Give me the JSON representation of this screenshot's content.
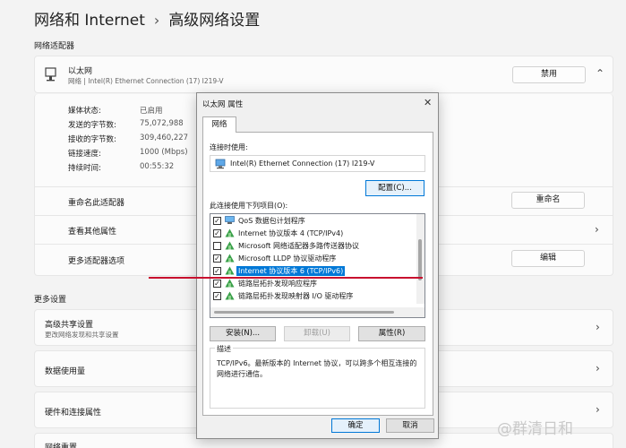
{
  "breadcrumb": {
    "parent": "网络和 Internet",
    "separator": "›",
    "current": "高级网络设置"
  },
  "adapters_section": {
    "label": "网络适配器",
    "adapter": {
      "name": "以太网",
      "desc": "网络 | Intel(R) Ethernet Connection (17) I219-V",
      "disable_label": "禁用",
      "properties": [
        {
          "label": "媒体状态:",
          "value": "已启用"
        },
        {
          "label": "发送的字节数:",
          "value": "75,072,988"
        },
        {
          "label": "接收的字节数:",
          "value": "309,460,227"
        },
        {
          "label": "链接速度:",
          "value": "1000 (Mbps)"
        },
        {
          "label": "持续时间:",
          "value": "00:55:32"
        }
      ],
      "rename_row": "重命名此适配器",
      "rename_button": "重命名",
      "more_props_row": "查看其他属性",
      "more_options_row": "更多适配器选项",
      "edit_button": "编辑"
    }
  },
  "more_settings": {
    "label": "更多设置",
    "sharing": {
      "title": "高级共享设置",
      "subtitle": "更改网络发现和共享设置"
    },
    "data_usage": "数据使用量",
    "hardware": "硬件和连接属性",
    "network_reset": "网络重置"
  },
  "dialog": {
    "title": "以太网 属性",
    "close": "✕",
    "tab": "网络",
    "connect_using_label": "连接时使用:",
    "device": "Intel(R) Ethernet Connection (17) I219-V",
    "configure_button": "配置(C)...",
    "items_label": "此连接使用下列项目(O):",
    "items": [
      {
        "checked": true,
        "text": "QoS 数据包计划程序",
        "icon": "qos-icon"
      },
      {
        "checked": true,
        "text": "Internet 协议版本 4 (TCP/IPv4)",
        "icon": "protocol-icon"
      },
      {
        "checked": false,
        "text": "Microsoft 网络适配器多路传送器协议",
        "icon": "protocol-icon"
      },
      {
        "checked": true,
        "text": "Microsoft LLDP 协议驱动程序",
        "icon": "protocol-icon"
      },
      {
        "checked": true,
        "text": "Internet 协议版本 6 (TCP/IPv6)",
        "icon": "protocol-icon",
        "selected": true
      },
      {
        "checked": true,
        "text": "链路层拓扑发现响应程序",
        "icon": "protocol-icon"
      },
      {
        "checked": true,
        "text": "链路层拓扑发现映射器 I/O 驱动程序",
        "icon": "protocol-icon"
      }
    ],
    "install_button": "安装(N)...",
    "uninstall_button": "卸载(U)",
    "properties_button": "属性(R)",
    "description_label": "描述",
    "description": "TCP/IPv6。最新版本的 Internet 协议，可以跨多个相互连接的网络进行通信。",
    "ok_button": "确定",
    "cancel_button": "取消"
  },
  "watermark": "@群清日和",
  "colors": {
    "accent": "#0078d7",
    "annotation_line": "#c8102e"
  }
}
